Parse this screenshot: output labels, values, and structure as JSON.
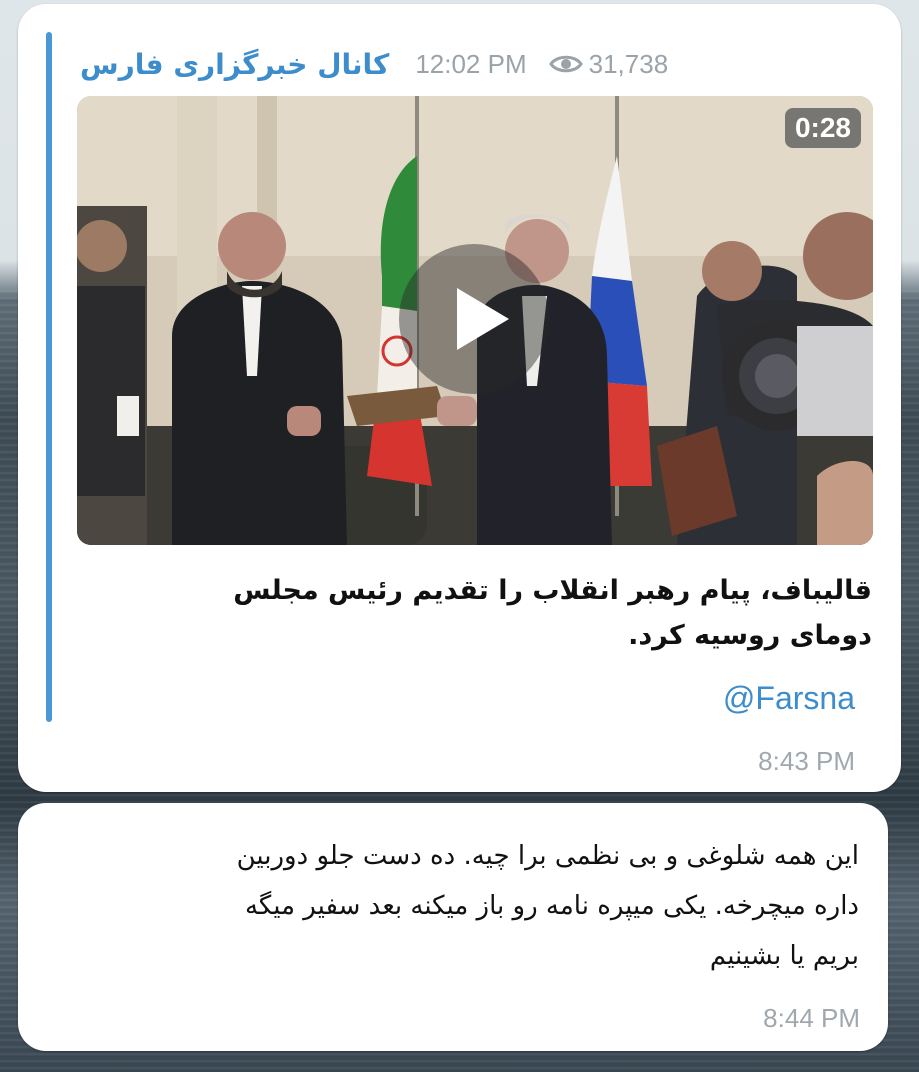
{
  "post": {
    "channel_name": "کانال خبرگزاری فارس",
    "time": "12:02 PM",
    "views": "31,738",
    "video": {
      "duration": "0:28",
      "play_icon": "play-icon"
    },
    "caption_lines": [
      "قالیباف، پیام رهبر انقلاب را تقدیم رئیس مجلس",
      "دومای روسیه کرد."
    ],
    "mention": "@Farsna",
    "footer_time": "8:43 PM",
    "accent_color": "#4a97d6"
  },
  "reply": {
    "text_lines": [
      "این همه شلوغی و بی نظمی برا چیه. ده دست جلو دوربین",
      "داره میچرخه. یکی میپره نامه رو باز میکنه بعد سفیر میگه",
      "بریم یا بشینیم"
    ],
    "time": "8:44 PM"
  }
}
